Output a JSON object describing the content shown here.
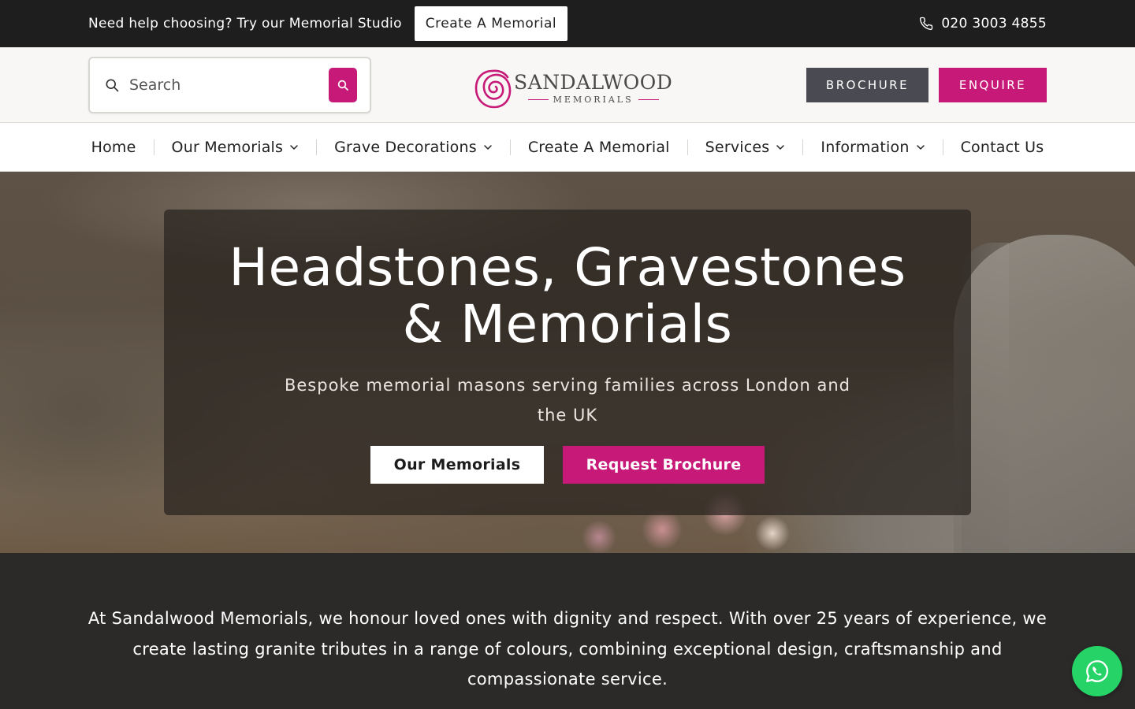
{
  "topbar": {
    "help_text": "Need help choosing? Try our Memorial Studio",
    "cta_label": "Create A Memorial",
    "phone": "020 3003 4855",
    "phone_icon": "phone-icon"
  },
  "header": {
    "search_placeholder": "Search",
    "search_icon": "search-icon",
    "logo": {
      "brand": "SANDALWOOD",
      "sub": "MEMORIALS",
      "icon": "rose-logo-icon"
    },
    "brochure_label": "BROCHURE",
    "enquire_label": "ENQUIRE"
  },
  "nav": {
    "items": [
      {
        "label": "Home",
        "dropdown": false
      },
      {
        "label": "Our Memorials",
        "dropdown": true
      },
      {
        "label": "Grave Decorations",
        "dropdown": true
      },
      {
        "label": "Create A Memorial",
        "dropdown": false
      },
      {
        "label": "Services",
        "dropdown": true
      },
      {
        "label": "Information",
        "dropdown": true
      },
      {
        "label": "Contact Us",
        "dropdown": false
      }
    ]
  },
  "hero": {
    "title_line1": "Headstones, Gravestones",
    "title_line2": "& Memorials",
    "subtitle": "Bespoke memorial masons serving families across London and the UK",
    "primary_button": "Our Memorials",
    "secondary_button": "Request Brochure"
  },
  "intro": {
    "text": "At Sandalwood Memorials, we honour loved ones with dignity and respect. With over 25 years of experience, we create lasting granite tributes in a range of colours, combining exceptional design, craftsmanship and compassionate service."
  },
  "whatsapp": {
    "icon": "whatsapp-icon"
  },
  "colors": {
    "accent": "#c71a78",
    "dark": "#1f1e1e",
    "brochure_button": "#4a4a52",
    "intro_bg": "#2b2a29",
    "whatsapp": "#25d366"
  }
}
